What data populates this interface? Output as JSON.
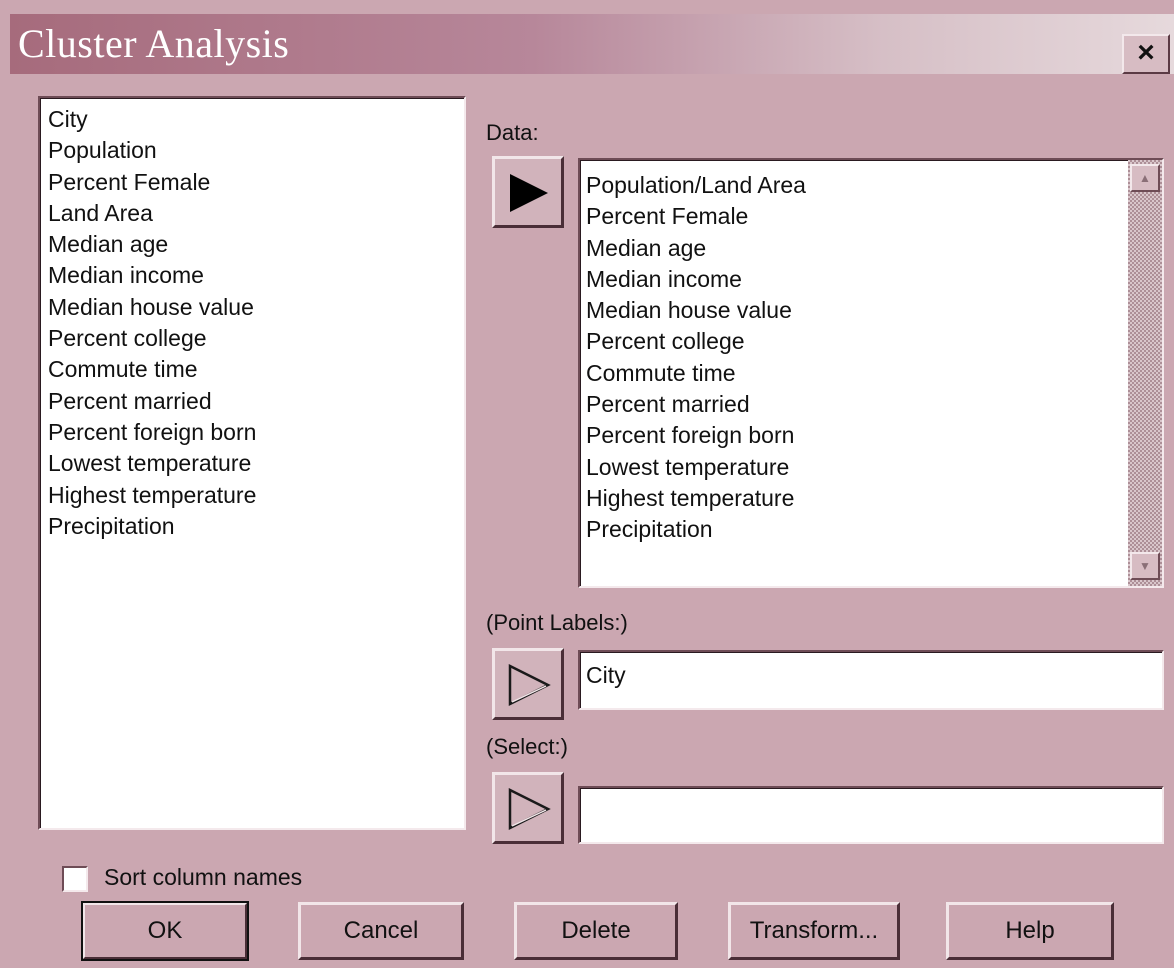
{
  "window": {
    "title": "Cluster Analysis",
    "close_label": "×"
  },
  "variables": {
    "items": [
      "City",
      "Population",
      "Percent Female",
      "Land Area",
      "Median age",
      "Median income",
      "Median house value",
      "Percent college",
      "Commute time",
      "Percent married",
      "Percent foreign born",
      "Lowest temperature",
      "Highest temperature",
      "Precipitation"
    ]
  },
  "data_section": {
    "label": "Data:",
    "items": [
      "Population/Land Area",
      "Percent Female",
      "Median age",
      "Median income",
      "Median house value",
      "Percent college",
      "Commute time",
      "Percent married",
      "Percent foreign born",
      "Lowest temperature",
      "Highest temperature",
      "Precipitation"
    ]
  },
  "point_labels": {
    "label": "(Point Labels:)",
    "value": "City"
  },
  "select": {
    "label": "(Select:)",
    "value": ""
  },
  "sort": {
    "label": "Sort column names",
    "checked": false
  },
  "buttons": {
    "ok": "OK",
    "cancel": "Cancel",
    "delete": "Delete",
    "transform": "Transform...",
    "help": "Help"
  },
  "icons": {
    "close": "close-icon",
    "arrow_active": "right-arrow-filled-icon",
    "arrow_inactive": "right-arrow-outline-icon",
    "scroll_up": "scroll-up-icon",
    "scroll_down": "scroll-down-icon"
  },
  "colors": {
    "dialog_bg": "#cba7b1",
    "titlebar_start": "#a66b7c",
    "titlebar_end": "#e6d9dc"
  }
}
